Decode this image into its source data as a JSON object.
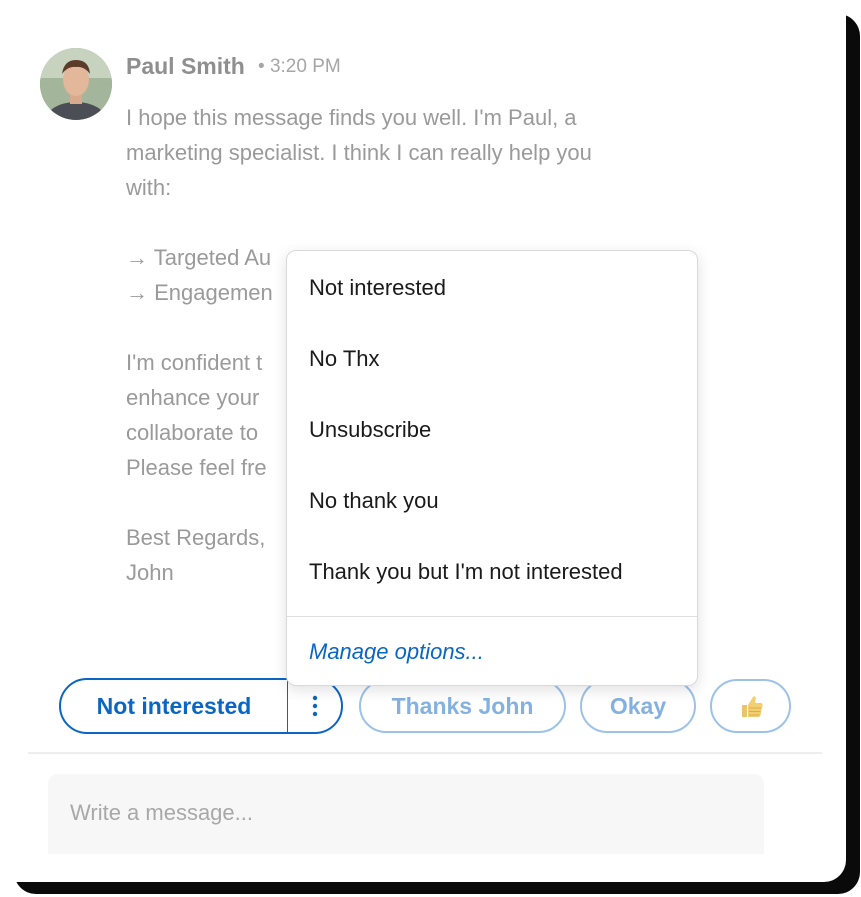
{
  "message": {
    "sender": "Paul Smith",
    "time": "3:20 PM",
    "paragraphs": [
      "I hope this message finds you well. I'm Paul, a",
      "marketing specialist. I think I can really help you",
      "with:",
      "",
      "→ Targeted Au",
      "→ Engagemen",
      "",
      "I'm confident t",
      "enhance your",
      "collaborate to",
      "Please feel fre",
      "",
      "Best Regards,",
      "John"
    ]
  },
  "dropdown": {
    "items": [
      "Not interested",
      "No Thx",
      "Unsubscribe",
      "No thank you",
      "Thank you but I'm not interested"
    ],
    "manage_label": "Manage options..."
  },
  "quick_replies": {
    "primary_label": "Not interested",
    "more_icon": "vertical-ellipsis-icon",
    "chips": [
      "Thanks John",
      "Okay"
    ],
    "thumbs_icon": "thumbs-up-emoji-icon"
  },
  "composer": {
    "placeholder": "Write a message..."
  },
  "colors": {
    "accent": "#0a66c2",
    "chip_border": "#9cc2e8",
    "muted_text": "#9a9a9a"
  }
}
